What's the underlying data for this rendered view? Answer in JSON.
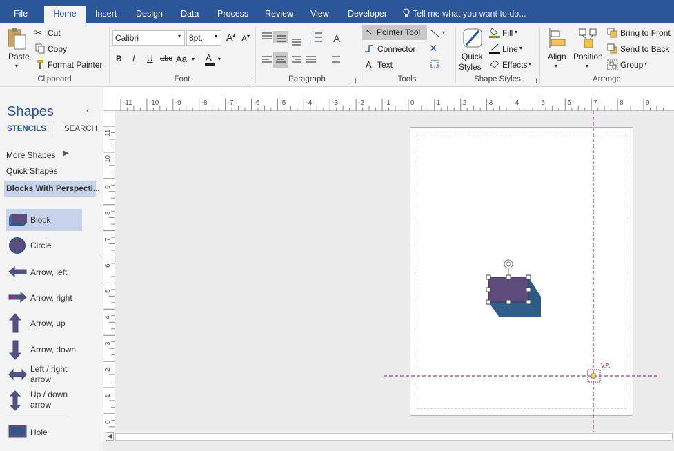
{
  "tabs": [
    "File",
    "Home",
    "Insert",
    "Design",
    "Data",
    "Process",
    "Review",
    "View",
    "Developer"
  ],
  "active_tab": "Home",
  "tell_me": "Tell me what you want to do...",
  "clipboard": {
    "paste": "Paste",
    "cut": "Cut",
    "copy": "Copy",
    "format_painter": "Format Painter",
    "group": "Clipboard"
  },
  "font": {
    "name": "Calibri",
    "size": "8pt.",
    "group": "Font",
    "bold": "B",
    "italic": "I",
    "underline": "U",
    "strike": "abc",
    "case": "Aa",
    "color": "A"
  },
  "paragraph": {
    "group": "Paragraph"
  },
  "tools": {
    "pointer": "Pointer Tool",
    "connector": "Connector",
    "text": "Text",
    "group": "Tools"
  },
  "shape_styles": {
    "quick": "Quick",
    "styles": "Styles",
    "fill": "Fill",
    "line": "Line",
    "effects": "Effects",
    "group": "Shape Styles"
  },
  "arrange": {
    "align": "Align",
    "position": "Position",
    "bring_front": "Bring to Front",
    "send_back": "Send to Back",
    "group_btn": "Group",
    "group": "Arrange"
  },
  "panel": {
    "title": "Shapes",
    "stencils": "STENCILS",
    "search": "SEARCH",
    "more_shapes": "More Shapes",
    "quick_shapes": "Quick Shapes",
    "active_stencil": "Blocks With Perspecti...",
    "items": [
      {
        "l1": "Block",
        "l2": ""
      },
      {
        "l1": "Circle",
        "l2": ""
      },
      {
        "l1": "Arrow, left",
        "l2": ""
      },
      {
        "l1": "Arrow, right",
        "l2": ""
      },
      {
        "l1": "Arrow, up",
        "l2": ""
      },
      {
        "l1": "Arrow, down",
        "l2": ""
      },
      {
        "l1": "Left / right",
        "l2": "arrow"
      },
      {
        "l1": "Up / down",
        "l2": "arrow"
      },
      {
        "l1": "Hole",
        "l2": ""
      }
    ]
  },
  "ruler_h": [
    "-11",
    "-10",
    "-9",
    "-8",
    "-7",
    "-6",
    "-5",
    "-4",
    "-3",
    "-2",
    "-1",
    "0",
    "1",
    "2",
    "3",
    "4",
    "5",
    "6",
    "7",
    "8",
    "9"
  ],
  "ruler_v": [
    "11",
    "10",
    "9",
    "8",
    "7",
    "6",
    "5",
    "4",
    "3",
    "2",
    "1",
    "0"
  ],
  "vanishing_point": "V.P.",
  "colors": {
    "accent": "#2b579a",
    "block_front": "#5c4d7d",
    "block_side": "#2e5984",
    "guide": "#7a1e7a"
  }
}
